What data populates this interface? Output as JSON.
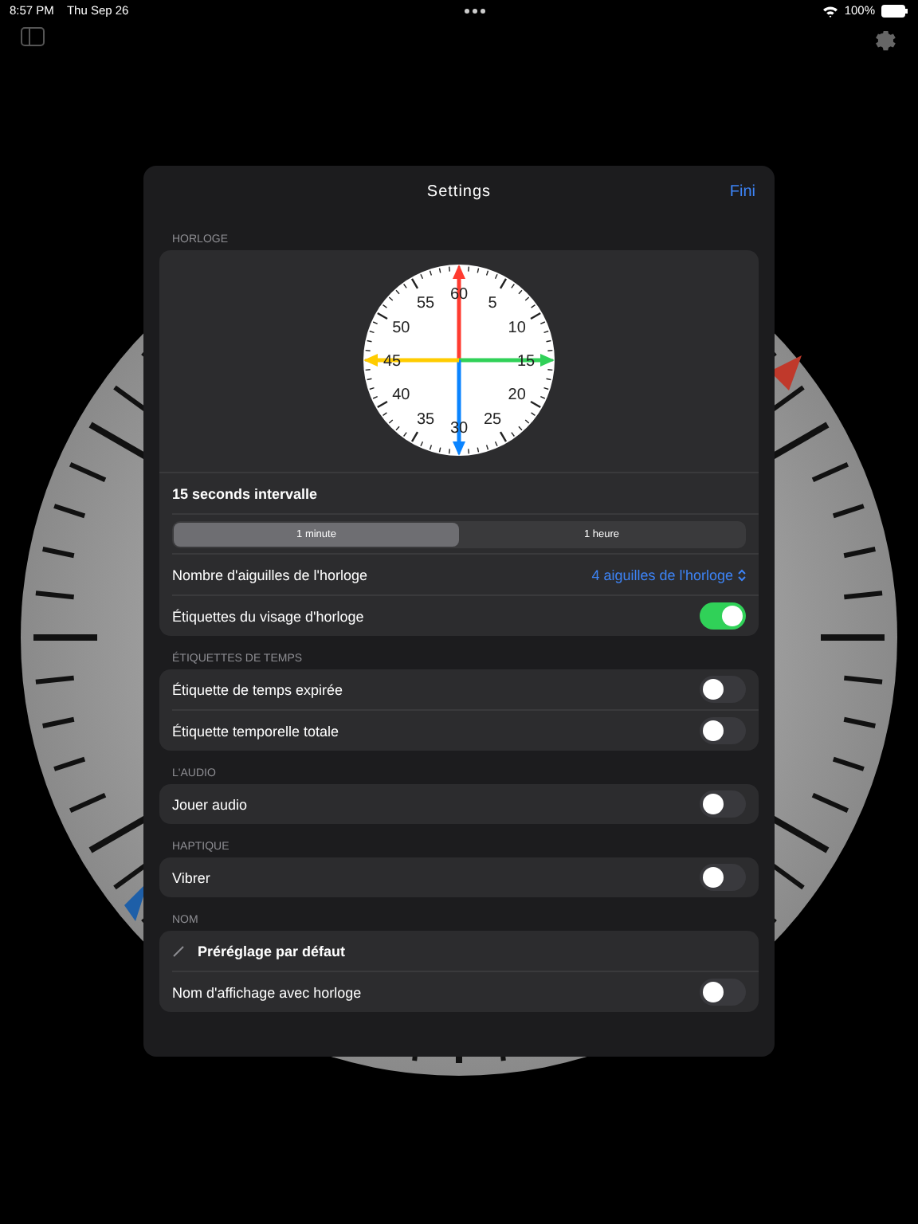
{
  "status_bar": {
    "time": "8:57 PM",
    "date": "Thu Sep 26",
    "battery": "100%"
  },
  "sheet": {
    "title": "Settings",
    "done": "Fini"
  },
  "sections": [
    {
      "header": "HORLOGE",
      "clock": {
        "labels": [
          "60",
          "5",
          "10",
          "15",
          "20",
          "25",
          "30",
          "35",
          "40",
          "45",
          "50",
          "55"
        ],
        "hands": [
          {
            "color": "#ff3b30"
          },
          {
            "color": "#30d158"
          },
          {
            "color": "#0a84ff"
          },
          {
            "color": "#ffcc00"
          }
        ]
      },
      "rows": [
        {
          "kind": "title",
          "label": "15 seconds intervalle"
        },
        {
          "kind": "segmented",
          "segments": [
            {
              "label": "1 minute",
              "selected": true
            },
            {
              "label": "1 heure",
              "selected": false
            }
          ]
        },
        {
          "kind": "picker",
          "label": "Nombre d'aiguilles de l'horloge",
          "value": "4 aiguilles de l'horloge"
        },
        {
          "kind": "toggle",
          "label": "Étiquettes du visage d'horloge",
          "on": true
        }
      ]
    },
    {
      "header": "ÉTIQUETTES DE TEMPS",
      "rows": [
        {
          "kind": "toggle",
          "label": "Étiquette de temps expirée",
          "on": false
        },
        {
          "kind": "toggle",
          "label": "Étiquette temporelle totale",
          "on": false
        }
      ]
    },
    {
      "header": "L'AUDIO",
      "rows": [
        {
          "kind": "toggle",
          "label": "Jouer audio",
          "on": false
        }
      ]
    },
    {
      "header": "HAPTIQUE",
      "rows": [
        {
          "kind": "toggle",
          "label": "Vibrer",
          "on": false
        }
      ]
    },
    {
      "header": "NOM",
      "rows": [
        {
          "kind": "name",
          "label": "Préréglage par défaut"
        },
        {
          "kind": "toggle",
          "label": "Nom d'affichage avec horloge",
          "on": false
        }
      ]
    }
  ]
}
